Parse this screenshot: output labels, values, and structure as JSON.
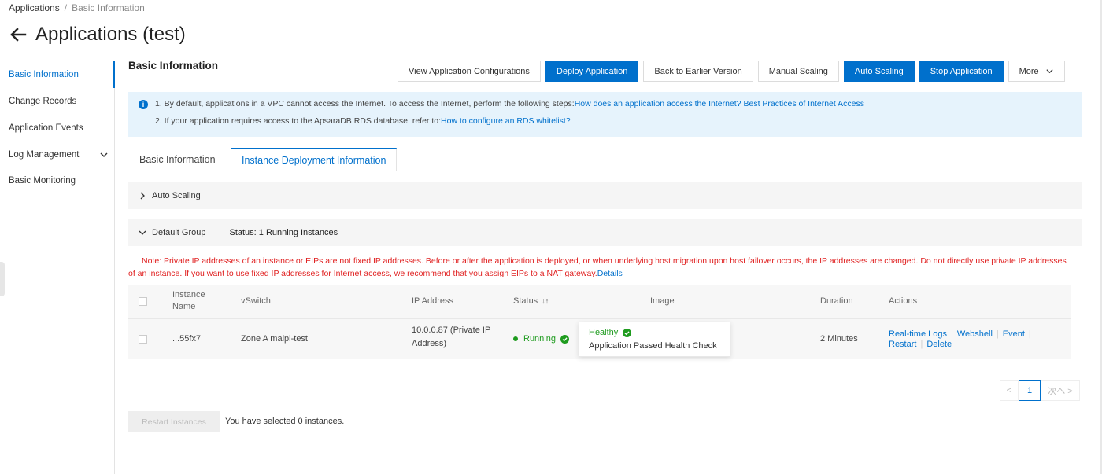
{
  "breadcrumb": {
    "root": "Applications",
    "separator": "/",
    "current": "Basic Information"
  },
  "page": {
    "title": "Applications (test)"
  },
  "sidebar": {
    "items": [
      {
        "label": "Basic Information",
        "active": true
      },
      {
        "label": "Change Records"
      },
      {
        "label": "Application Events"
      },
      {
        "label": "Log Management",
        "expandable": true
      },
      {
        "label": "Basic Monitoring"
      }
    ]
  },
  "section": {
    "title": "Basic Information"
  },
  "toolbar": {
    "view_config": "View Application Configurations",
    "deploy": "Deploy Application",
    "rollback": "Back to Earlier Version",
    "manual_scaling": "Manual Scaling",
    "auto_scaling": "Auto Scaling",
    "stop": "Stop Application",
    "more": "More"
  },
  "info": {
    "line1_text": "1. By default, applications in a VPC cannot access the Internet. To access the Internet, perform the following steps:",
    "line1_link": "How does an application access the Internet? Best Practices of Internet Access",
    "line2_text": "2. If your application requires access to the ApsaraDB RDS database, refer to:",
    "line2_link": "How to configure an RDS whitelist?"
  },
  "tabs": [
    {
      "label": "Basic Information"
    },
    {
      "label": "Instance Deployment Information",
      "active": true
    }
  ],
  "auto_scaling_panel": {
    "label": "Auto Scaling"
  },
  "default_group": {
    "label": "Default Group",
    "status": "Status: 1 Running Instances"
  },
  "note": {
    "text": "Note: Private IP addresses of an instance or EIPs are not fixed IP addresses. Before or after the application is deployed, or when underlying host migration upon host failover occurs, the IP addresses are changed. Do not directly use private IP addresses of an instance. If you want to use fixed IP addresses for Internet access, we recommend that you assign EIPs to a NAT gateway.",
    "link": "Details"
  },
  "table": {
    "headers": {
      "instance_name_1": "Instance",
      "instance_name_2": "Name",
      "vswitch": "vSwitch",
      "ip": "IP Address",
      "status": "Status",
      "status_sort": "↓↑",
      "image": "Image",
      "duration": "Duration",
      "actions": "Actions"
    },
    "rows": [
      {
        "instance_name": "...55fx7",
        "vswitch": "Zone A maipi-test",
        "ip_line1": "10.0.0.87 (Private IP",
        "ip_line2": "Address)",
        "status": "Running",
        "duration": "2 Minutes",
        "actions": [
          "Real-time Logs",
          "Webshell",
          "Event",
          "Restart",
          "Delete"
        ]
      }
    ]
  },
  "tooltip": {
    "title": "Healthy",
    "text": "Application Passed Health Check"
  },
  "pagination": {
    "prev": "<",
    "current": "1",
    "next": "次へ >"
  },
  "footer": {
    "restart_button": "Restart Instances",
    "selected_text": "You have selected 0 instances."
  },
  "colors": {
    "primary": "#0070cc",
    "info_bg": "#e6f3fc",
    "danger": "#e02020",
    "success": "#1e9b1e"
  }
}
